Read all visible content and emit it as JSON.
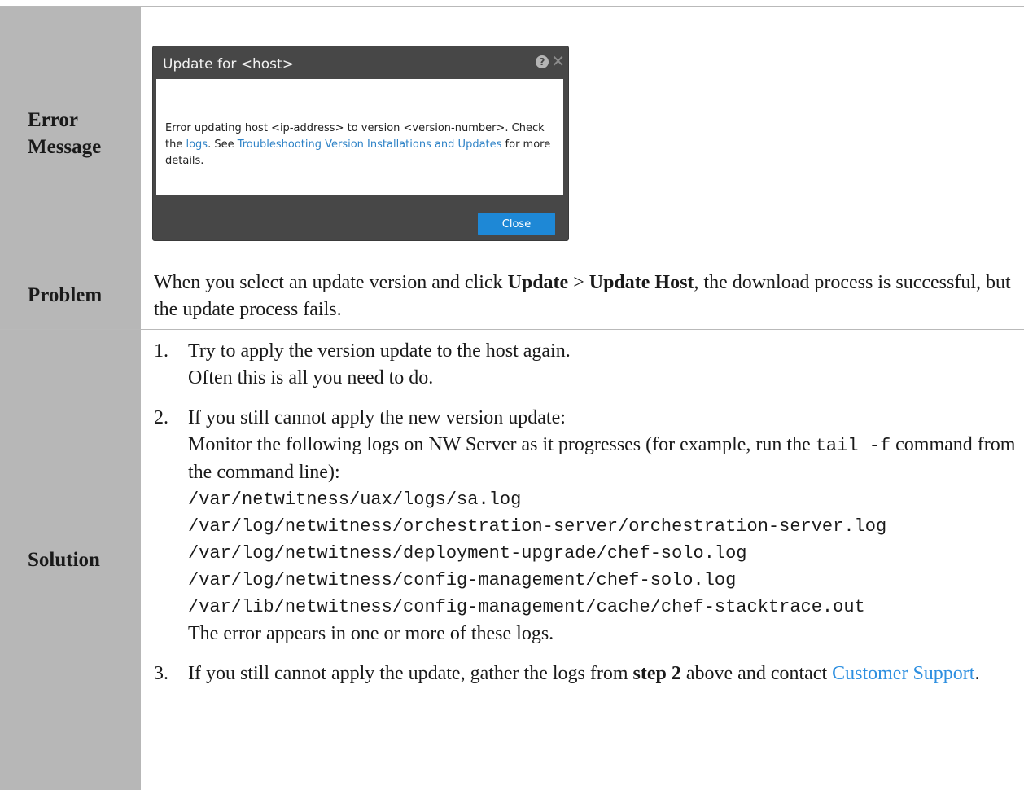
{
  "rows": {
    "error_label": "Error Message",
    "problem_label": "Problem",
    "solution_label": "Solution"
  },
  "dialog": {
    "title": "Update for <host>",
    "help_icon": "question-circle-icon",
    "close_icon": "close-icon",
    "body_pre": "Error updating host <ip-address> to version <version-number>. Check the ",
    "logs_link": "logs",
    "body_mid": ".  See ",
    "troubleshoot_link": "Troubleshooting Version Installations and Updates",
    "body_post": " for more details.",
    "close_button": "Close"
  },
  "problem": {
    "pre": "When you select an update version and click ",
    "bold1": "Update",
    "sep": " > ",
    "bold2": "Update Host",
    "post": ", the download process is successful, but the update process fails."
  },
  "solution": {
    "step1": {
      "num": "1.",
      "line1": "Try to apply the version update to the host again.",
      "line2": "Often this is all you need to do."
    },
    "step2": {
      "num": "2.",
      "line1": "If you still cannot apply the new version update:",
      "monitor_pre": "Monitor the following logs on NW Server as it progresses (for example, run the ",
      "monitor_code": "tail -f",
      "monitor_post": " command from the command line):",
      "logs": [
        "/var/netwitness/uax/logs/sa.log",
        "/var/log/netwitness/orchestration-server/orchestration-server.log",
        "/var/log/netwitness/deployment-upgrade/chef-solo.log",
        "/var/log/netwitness/config-management/chef-solo.log",
        "/var/lib/netwitness/config-management/cache/chef-stacktrace.out"
      ],
      "footer": "The error appears in one or more of these logs."
    },
    "step3": {
      "num": "3.",
      "pre": "If you still cannot apply the update, gather the logs from ",
      "bold": "step 2",
      "mid": " above and contact ",
      "link": "Customer Support",
      "post": "."
    }
  },
  "colors": {
    "label_bg": "#b7b7b7",
    "dialog_bg": "#474747",
    "button_blue": "#1e88d6",
    "link_blue": "#2d8fe0"
  }
}
